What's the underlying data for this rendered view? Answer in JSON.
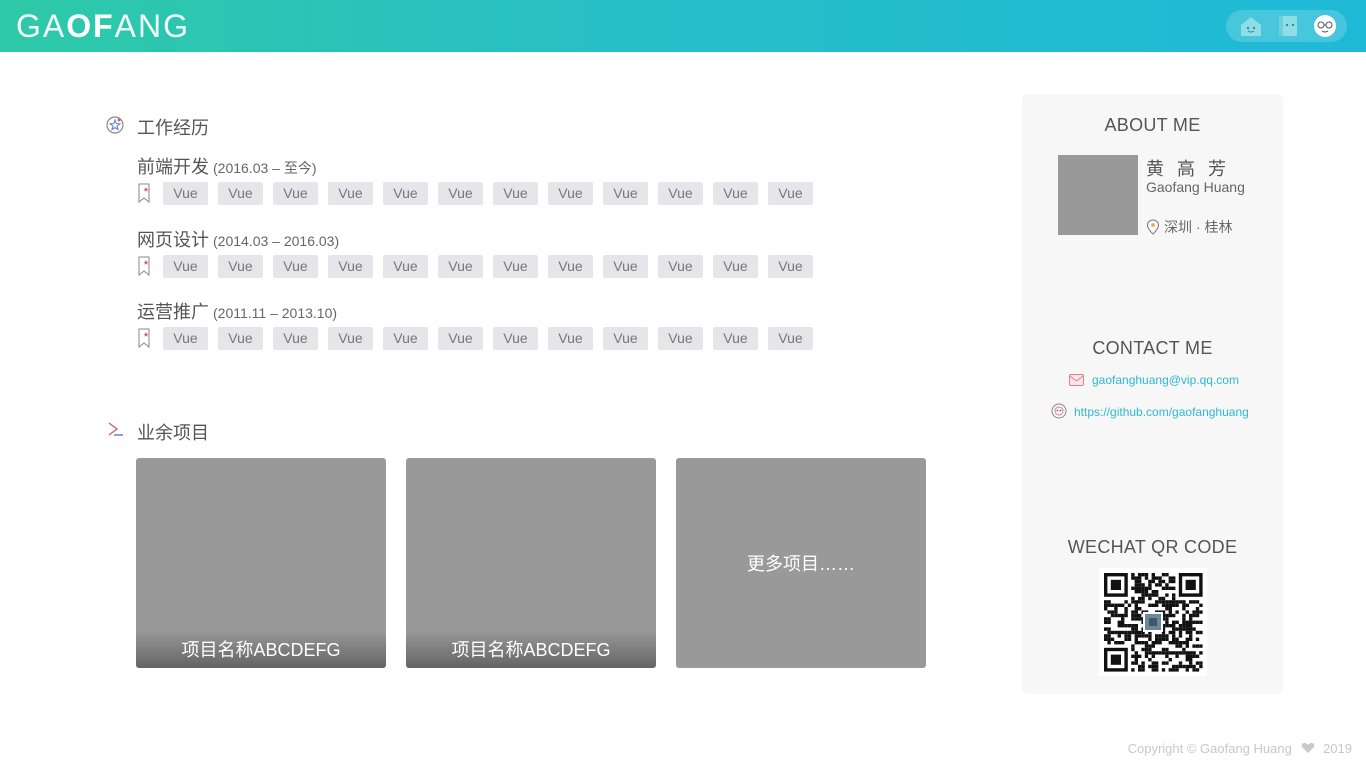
{
  "header": {
    "logo_part1": "GA",
    "logo_part2": "OF",
    "logo_part3": "ANG",
    "nav": [
      {
        "name": "home-icon"
      },
      {
        "name": "book-icon"
      },
      {
        "name": "face-icon"
      }
    ],
    "accent_start": "#2ec9a8",
    "accent_end": "#1fb9d8"
  },
  "work": {
    "title": "工作经历",
    "jobs": [
      {
        "role": "前端开发",
        "period": "(2016.03 – 至今)",
        "tags": [
          "Vue",
          "Vue",
          "Vue",
          "Vue",
          "Vue",
          "Vue",
          "Vue",
          "Vue",
          "Vue",
          "Vue",
          "Vue",
          "Vue"
        ]
      },
      {
        "role": "网页设计",
        "period": "(2014.03 – 2016.03)",
        "tags": [
          "Vue",
          "Vue",
          "Vue",
          "Vue",
          "Vue",
          "Vue",
          "Vue",
          "Vue",
          "Vue",
          "Vue",
          "Vue",
          "Vue"
        ]
      },
      {
        "role": "运营推广",
        "period": "(2011.11 – 2013.10)",
        "tags": [
          "Vue",
          "Vue",
          "Vue",
          "Vue",
          "Vue",
          "Vue",
          "Vue",
          "Vue",
          "Vue",
          "Vue",
          "Vue",
          "Vue"
        ]
      }
    ]
  },
  "projects": {
    "title": "业余项目",
    "items": [
      {
        "caption": "项目名称ABCDEFG"
      },
      {
        "caption": "项目名称ABCDEFG"
      }
    ],
    "more": "更多项目……"
  },
  "about": {
    "heading": "ABOUT ME",
    "name_cn": "黄 高 芳",
    "name_en": "Gaofang Huang",
    "location": "深圳 · 桂林"
  },
  "contact": {
    "heading": "CONTACT ME",
    "email": "gaofanghuang@vip.qq.com",
    "github": "https://github.com/gaofanghuang"
  },
  "wechat": {
    "heading": "WECHAT QR CODE"
  },
  "footer": {
    "copyright": "Copyright © Gaofang Huang",
    "year": "2019"
  }
}
